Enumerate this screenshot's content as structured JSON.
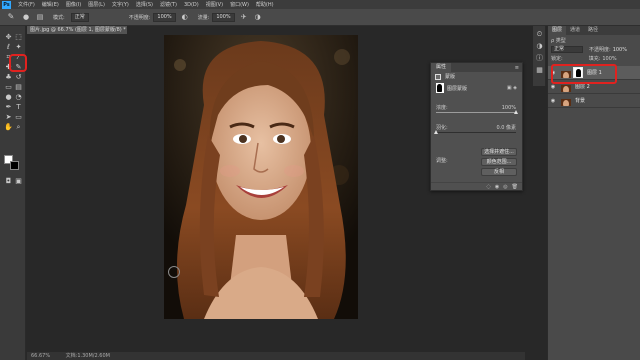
{
  "menubar": {
    "logo": "Ps",
    "items": [
      "文件(F)",
      "编辑(E)",
      "图像(I)",
      "图层(L)",
      "文字(Y)",
      "选择(S)",
      "滤镜(T)",
      "3D(D)",
      "视图(V)",
      "窗口(W)",
      "帮助(H)"
    ]
  },
  "options": {
    "tool_icon": "brush-icon",
    "mode_label": "模式:",
    "mode_value": "正常",
    "opacity_label": "不透明度:",
    "opacity_value": "100%",
    "flow_label": "流量:",
    "flow_value": "100%"
  },
  "document_tab": {
    "title": "图片.jpg @ 66.7% (图层 1, 图层蒙版/8) *",
    "close": "×"
  },
  "tools": [
    "move-icon",
    "marquee-icon",
    "lasso-icon",
    "magic-wand-icon",
    "crop-icon",
    "eyedropper-icon",
    "healing-icon",
    "brush-icon",
    "stamp-icon",
    "history-brush-icon",
    "eraser-icon",
    "gradient-icon",
    "blur-icon",
    "dodge-icon",
    "pen-icon",
    "text-icon",
    "path-select-icon",
    "shape-icon",
    "hand-icon",
    "zoom-icon"
  ],
  "colors": {
    "foreground": "#ffffff",
    "background": "#000000",
    "highlight": "#e0221f"
  },
  "status": {
    "zoom": "66.67%",
    "doc_info": "文档:1.30M/2.60M"
  },
  "properties": {
    "tab_label": "属性",
    "menu": "≡",
    "section_label": "蒙版",
    "mask_label": "图层蒙版",
    "mask_icons": "▣ ◈",
    "density_label": "浓度:",
    "density_value": "100%",
    "density_fraction": 1.0,
    "feather_label": "羽化:",
    "feather_value": "0.0 像素",
    "feather_fraction": 0.0,
    "refine_label": "调整:",
    "buttons": [
      "选择并遮住...",
      "颜色范围...",
      "反相"
    ],
    "footer_icons": [
      "◌",
      "◉",
      "◎",
      "🗑"
    ]
  },
  "layers_panel": {
    "tabs": [
      "图层",
      "通道",
      "路径"
    ],
    "kind_label": "ρ 类型",
    "blend_mode": "正常",
    "opacity_label": "不透明度:",
    "opacity_value": "100%",
    "lock_label": "锁定:",
    "fill_label": "填充:",
    "fill_value": "100%",
    "layers": [
      {
        "name": "图层 1",
        "selected": true,
        "has_mask": true
      },
      {
        "name": "图层 2",
        "selected": false,
        "has_mask": false
      },
      {
        "name": "背景",
        "selected": false,
        "has_mask": false
      }
    ]
  }
}
